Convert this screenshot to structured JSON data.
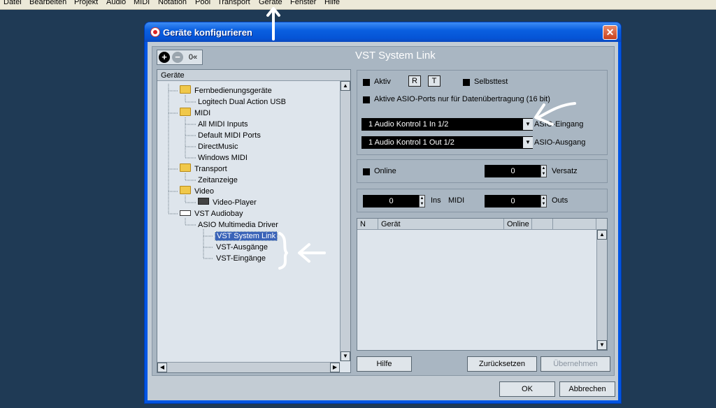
{
  "menubar": {
    "items": [
      "Datei",
      "Bearbeiten",
      "Projekt",
      "Audio",
      "MIDI",
      "Notation",
      "Pool",
      "Transport",
      "Geräte",
      "Fenster",
      "Hilfe"
    ]
  },
  "dialog": {
    "title": "Geräte konfigurieren",
    "close_label": "✕",
    "toolbar": {
      "add": "+",
      "remove": "−",
      "reset": "0«"
    },
    "section_title": "VST System Link",
    "tree": {
      "header": "Geräte",
      "nodes": [
        {
          "label": "Fernbedienungsgeräte",
          "icon": "folder-icon"
        },
        {
          "label": "Logitech Dual Action USB",
          "icon": ""
        },
        {
          "label": "MIDI",
          "icon": "folder-icon"
        },
        {
          "label": "All MIDI Inputs",
          "icon": ""
        },
        {
          "label": "Default MIDI Ports",
          "icon": ""
        },
        {
          "label": "DirectMusic",
          "icon": ""
        },
        {
          "label": "Windows MIDI",
          "icon": ""
        },
        {
          "label": "Transport",
          "icon": "folder-icon"
        },
        {
          "label": "Zeitanzeige",
          "icon": ""
        },
        {
          "label": "Video",
          "icon": "folder-icon"
        },
        {
          "label": "Video-Player",
          "icon": "video-device-icon"
        },
        {
          "label": "VST Audiobay",
          "icon": "audio-device-icon"
        },
        {
          "label": "ASIO Multimedia Driver",
          "icon": ""
        },
        {
          "label": "VST System Link",
          "icon": ""
        },
        {
          "label": "VST-Ausgänge",
          "icon": ""
        },
        {
          "label": "VST-Eingänge",
          "icon": ""
        }
      ]
    },
    "settings": {
      "aktiv": "Aktiv",
      "r": "R",
      "t": "T",
      "selbsttest": "Selbsttest",
      "asio_ports": "Aktive ASIO-Ports nur für Datenübertragung (16 bit)",
      "asio_in_value": "1 Audio Kontrol 1 In 1/2",
      "asio_in_label": "ASIO-Eingang",
      "asio_out_value": "1 Audio Kontrol 1 Out 1/2",
      "asio_out_label": "ASIO-Ausgang",
      "online": "Online",
      "versatz_value": "0",
      "versatz_label": "Versatz",
      "ins_value": "0",
      "ins_label": "Ins",
      "midi_label": "MIDI",
      "outs_value": "0",
      "outs_label": "Outs"
    },
    "grid": {
      "columns": [
        "N",
        "Gerät",
        "Online"
      ]
    },
    "buttons": {
      "hilfe": "Hilfe",
      "zuruecksetzen": "Zurücksetzen",
      "uebernehmen": "Übernehmen",
      "ok": "OK",
      "abbrechen": "Abbrechen"
    }
  },
  "colors": {
    "desktop": "#1f3a55",
    "panel": "#a9b6c2",
    "titlebar": "#0a5fe0",
    "annotation": "#ffffff"
  }
}
